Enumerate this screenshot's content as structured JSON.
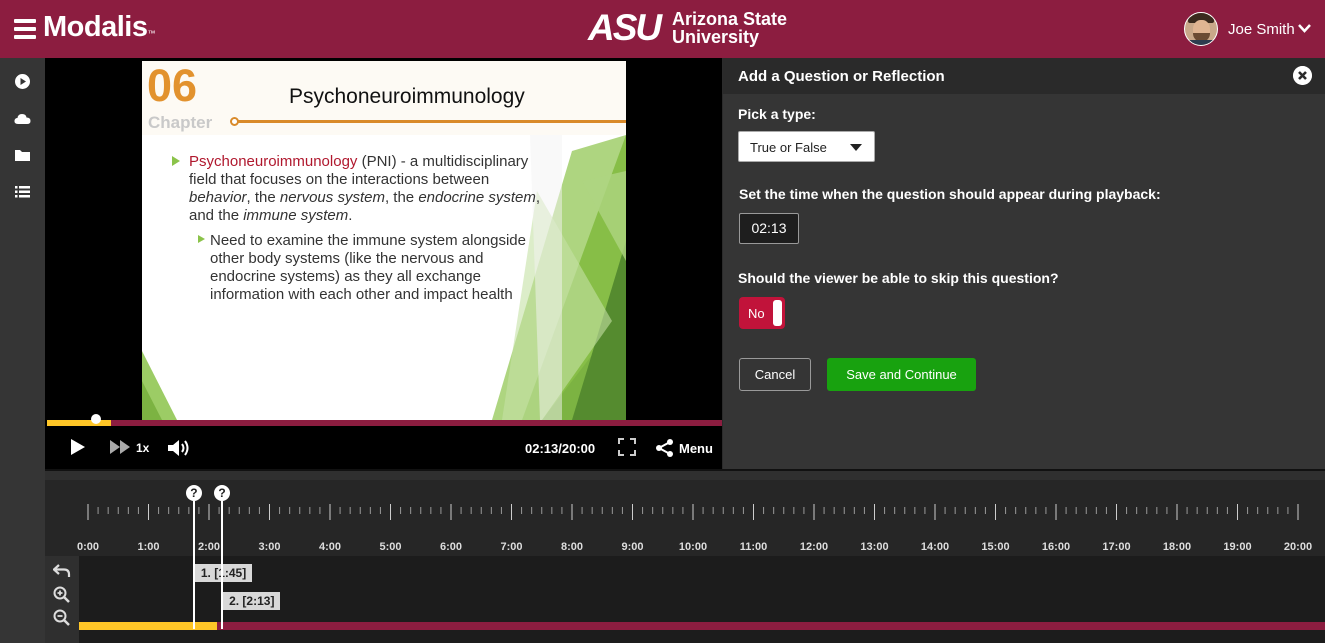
{
  "header": {
    "brand": "Modalis",
    "brand_tm": "™",
    "university_mark": "ASU",
    "university_name_line1": "Arizona State",
    "university_name_line2": "University",
    "user_name": "Joe Smith",
    "bg_color": "#8c1d40"
  },
  "sidebar": {
    "items": [
      {
        "icon": "play-circle-icon"
      },
      {
        "icon": "cloud-icon"
      },
      {
        "icon": "folder-icon"
      },
      {
        "icon": "list-icon"
      }
    ]
  },
  "slide": {
    "number": "06",
    "chapter": "Chapter",
    "title": "Psychoneuroimmunology",
    "bullet1_term": "Psychoneuroimmunology",
    "bullet1_line1_rest": " (PNI) - a multidisciplinary",
    "bullet1_line2": "field that focuses on the interactions between",
    "bullet1_line3_a": "behavior",
    "bullet1_line3_b": ", the ",
    "bullet1_line3_c": "nervous system",
    "bullet1_line3_d": ", the ",
    "bullet1_line3_e": "endocrine system",
    "bullet1_line3_f": ",",
    "bullet1_line4_a": "and the ",
    "bullet1_line4_b": "immune system",
    "bullet1_line4_c": ".",
    "bullet2_line1": "Need to examine the immune system alongside",
    "bullet2_line2": "other body systems (like the nervous and",
    "bullet2_line3": "endocrine systems) as they all exchange",
    "bullet2_line4": "information with each other and impact health"
  },
  "player": {
    "speed": "1x",
    "time_display": "02:13/20:00",
    "menu_label": "Menu",
    "progress_fraction": 0.095
  },
  "panel": {
    "title": "Add a Question or Reflection",
    "type_label": "Pick a type:",
    "type_value": "True or False",
    "time_label": "Set the time when the question should appear during playback:",
    "time_value": "02:13",
    "skip_label": "Should the viewer be able to skip this question?",
    "skip_value": "No",
    "cancel_label": "Cancel",
    "save_label": "Save and Continue",
    "save_color": "#18a20f"
  },
  "timeline": {
    "ticks": [
      "0:00",
      "1:00",
      "2:00",
      "3:00",
      "4:00",
      "5:00",
      "6:00",
      "7:00",
      "8:00",
      "9:00",
      "10:00",
      "11:00",
      "12:00",
      "13:00",
      "14:00",
      "15:00",
      "16:00",
      "17:00",
      "18:00",
      "19:00",
      "20:00"
    ],
    "marker_glyph": "?",
    "questions": [
      {
        "label": "1. [1:45]",
        "seconds": 105
      },
      {
        "label": "2. [2:13]",
        "seconds": 133
      }
    ],
    "total_seconds": 1200,
    "progress_fraction": 0.111
  }
}
